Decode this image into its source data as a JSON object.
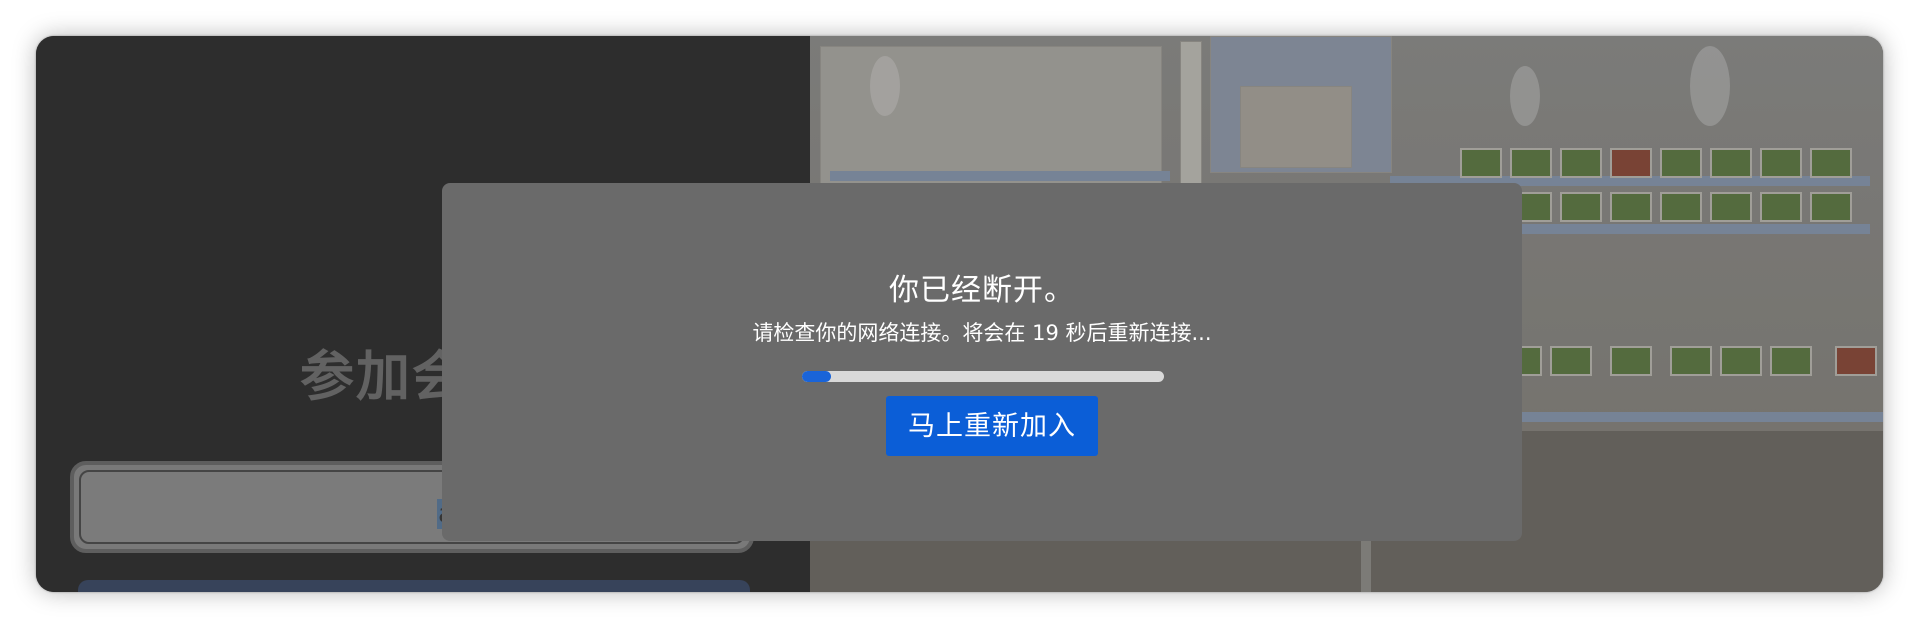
{
  "background": {
    "join_title": "参加会",
    "name_input_value": "asd"
  },
  "dialog": {
    "title": "你已经断开。",
    "message": "请检查你的网络连接。将会在 19 秒后重新连接...",
    "reconnect_progress": 0.08,
    "rejoin_button": "马上重新加入"
  },
  "colors": {
    "accent": "#0b5ed7",
    "progress": "#1a64d8",
    "modal_bg": "#6a6a6a",
    "left_panel_bg": "#313131"
  }
}
